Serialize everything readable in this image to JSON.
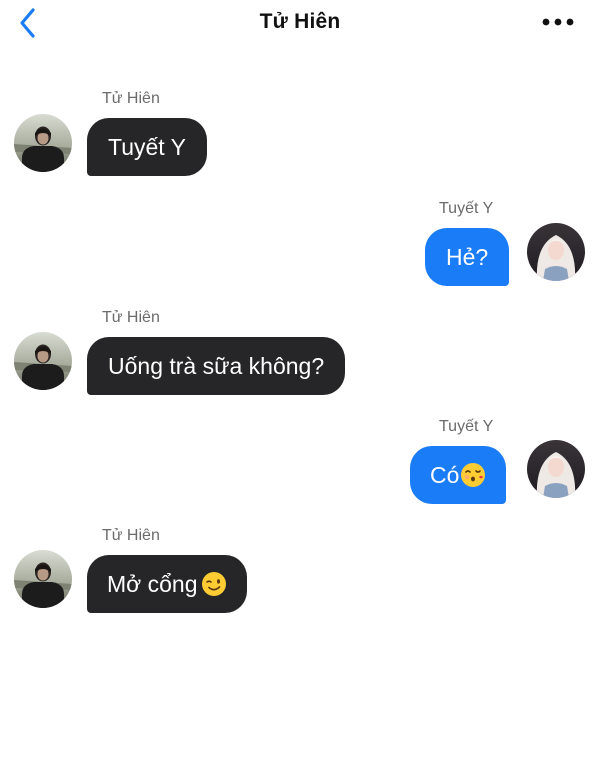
{
  "header": {
    "title": "Tử Hiên",
    "back_icon": "chevron-left-icon",
    "more_icon": "more-horizontal-icon",
    "accent_color": "#1b7cf7"
  },
  "messages": [
    {
      "sender": "Tử Hiên",
      "text": "Tuyết Y",
      "direction": "incoming"
    },
    {
      "sender": "Tuyết Y",
      "text": "Hẻ?",
      "direction": "outgoing"
    },
    {
      "sender": "Tử Hiên",
      "text": "Uống trà sữa không?",
      "direction": "incoming"
    },
    {
      "sender": "Tuyết Y",
      "text": "Có",
      "emoji": "kissing-face-emoji",
      "direction": "outgoing"
    },
    {
      "sender": "Tử Hiên",
      "text": "Mở cổng",
      "emoji": "winking-face-emoji",
      "direction": "incoming"
    }
  ],
  "colors": {
    "incoming_bubble": "#262628",
    "outgoing_bubble": "#1b7cf7",
    "sender_name": "#6b6b6b"
  }
}
